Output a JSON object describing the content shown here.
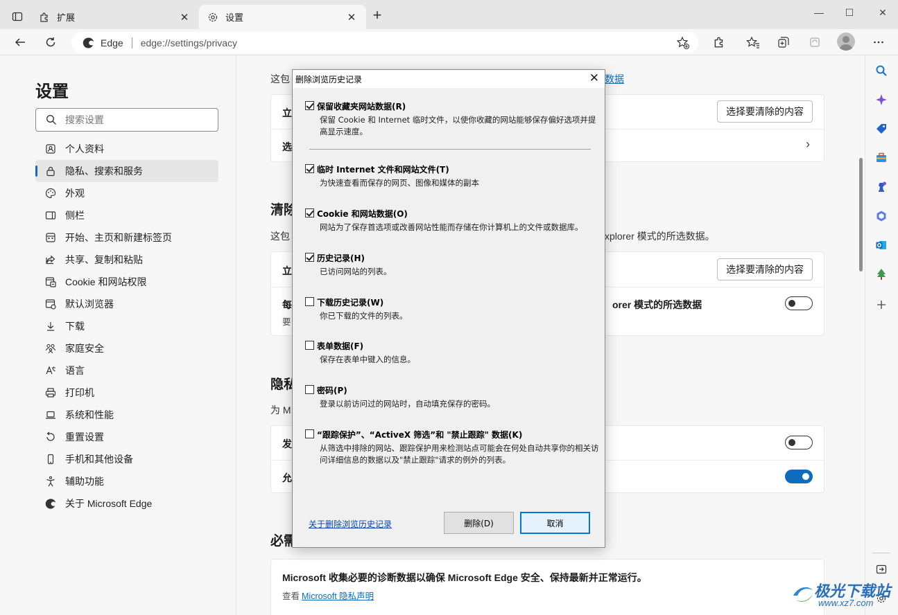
{
  "tabs": [
    {
      "label": "扩展",
      "icon": "puzzle-icon"
    },
    {
      "label": "设置",
      "icon": "gear-icon"
    }
  ],
  "toolbar": {
    "site_name": "Edge",
    "url": "edge://settings/privacy"
  },
  "nav": {
    "title": "设置",
    "search_placeholder": "搜索设置",
    "items": [
      {
        "label": "个人资料",
        "icon": "profile-icon"
      },
      {
        "label": "隐私、搜索和服务",
        "icon": "lock-icon",
        "selected": true
      },
      {
        "label": "外观",
        "icon": "palette-icon"
      },
      {
        "label": "侧栏",
        "icon": "sidebar-icon"
      },
      {
        "label": "开始、主页和新建标签页",
        "icon": "home-icon"
      },
      {
        "label": "共享、复制和粘贴",
        "icon": "share-icon"
      },
      {
        "label": "Cookie 和网站权限",
        "icon": "site-permissions-icon"
      },
      {
        "label": "默认浏览器",
        "icon": "browser-icon"
      },
      {
        "label": "下载",
        "icon": "download-icon"
      },
      {
        "label": "家庭安全",
        "icon": "family-icon"
      },
      {
        "label": "语言",
        "icon": "language-icon"
      },
      {
        "label": "打印机",
        "icon": "printer-icon"
      },
      {
        "label": "系统和性能",
        "icon": "laptop-icon"
      },
      {
        "label": "重置设置",
        "icon": "reset-icon"
      },
      {
        "label": "手机和其他设备",
        "icon": "phone-icon"
      },
      {
        "label": "辅助功能",
        "icon": "accessibility-icon"
      },
      {
        "label": "关于 Microsoft Edge",
        "icon": "edge-icon"
      }
    ]
  },
  "main": {
    "section1_desc_start": "这包",
    "section1_desc_link": "数据",
    "card1_row1_label": "立",
    "card1_row1_button": "选择要清除的内容",
    "card1_row2_label": "选",
    "section2_heading": "清除",
    "section2_desc_start": "这包",
    "section2_desc_end": "xplorer 模式的所选数据。",
    "card2_row1_label": "立",
    "card2_row1_button": "选择要清除的内容",
    "card2_row2_label_start": "每",
    "card2_row2_label_end": "orer 模式的所选数据",
    "card2_row2_sub": "要",
    "section3_heading": "隐私",
    "section3_desc": "为 M",
    "card3_row1_label": "发",
    "card3_row2_label": "允",
    "section4_heading": "必需",
    "card4_text": "Microsoft 收集必要的诊断数据以确保 Microsoft Edge 安全、保持最新并正常运行。",
    "card4_sub_prefix": "查看",
    "card4_link": "Microsoft 隐私声明"
  },
  "dialog": {
    "title": "删除浏览历史记录",
    "options": [
      {
        "label": "保留收藏夹网站数据(R)",
        "checked": true,
        "desc": "保留 Cookie 和 Internet 临时文件，以使你收藏的网站能够保存偏好选项并提高显示速度。"
      },
      {
        "label": "临时 Internet 文件和网站文件(T)",
        "checked": true,
        "desc": "为快速查看而保存的网页、图像和媒体的副本"
      },
      {
        "label": "Cookie 和网站数据(O)",
        "checked": true,
        "desc": "网站为了保存首选项或改善网站性能而存储在你计算机上的文件或数据库。"
      },
      {
        "label": "历史记录(H)",
        "checked": true,
        "desc": "已访问网站的列表。"
      },
      {
        "label": "下载历史记录(W)",
        "checked": false,
        "desc": "你已下载的文件的列表。"
      },
      {
        "label": "表单数据(F)",
        "checked": false,
        "desc": "保存在表单中键入的信息。"
      },
      {
        "label": "密码(P)",
        "checked": false,
        "desc": "登录以前访问过的网站时，自动填充保存的密码。"
      },
      {
        "label": "“跟踪保护”、“ActiveX 筛选”和 \"禁止跟踪\" 数据(K)",
        "checked": false,
        "desc": "从筛选中排除的网站、跟踪保护用来检测站点可能会在何处自动共享你的相关访问详细信息的数据以及\"禁止跟踪\"请求的例外的列表。"
      }
    ],
    "help_link": "关于删除浏览历史记录",
    "delete_button": "删除(D)",
    "cancel_button": "取消"
  },
  "watermark": {
    "text": "极光下载站",
    "url": "www.xz7.com"
  },
  "colors": {
    "accent": "#0f6cbd",
    "dialog_bg": "#f0f0f0"
  }
}
